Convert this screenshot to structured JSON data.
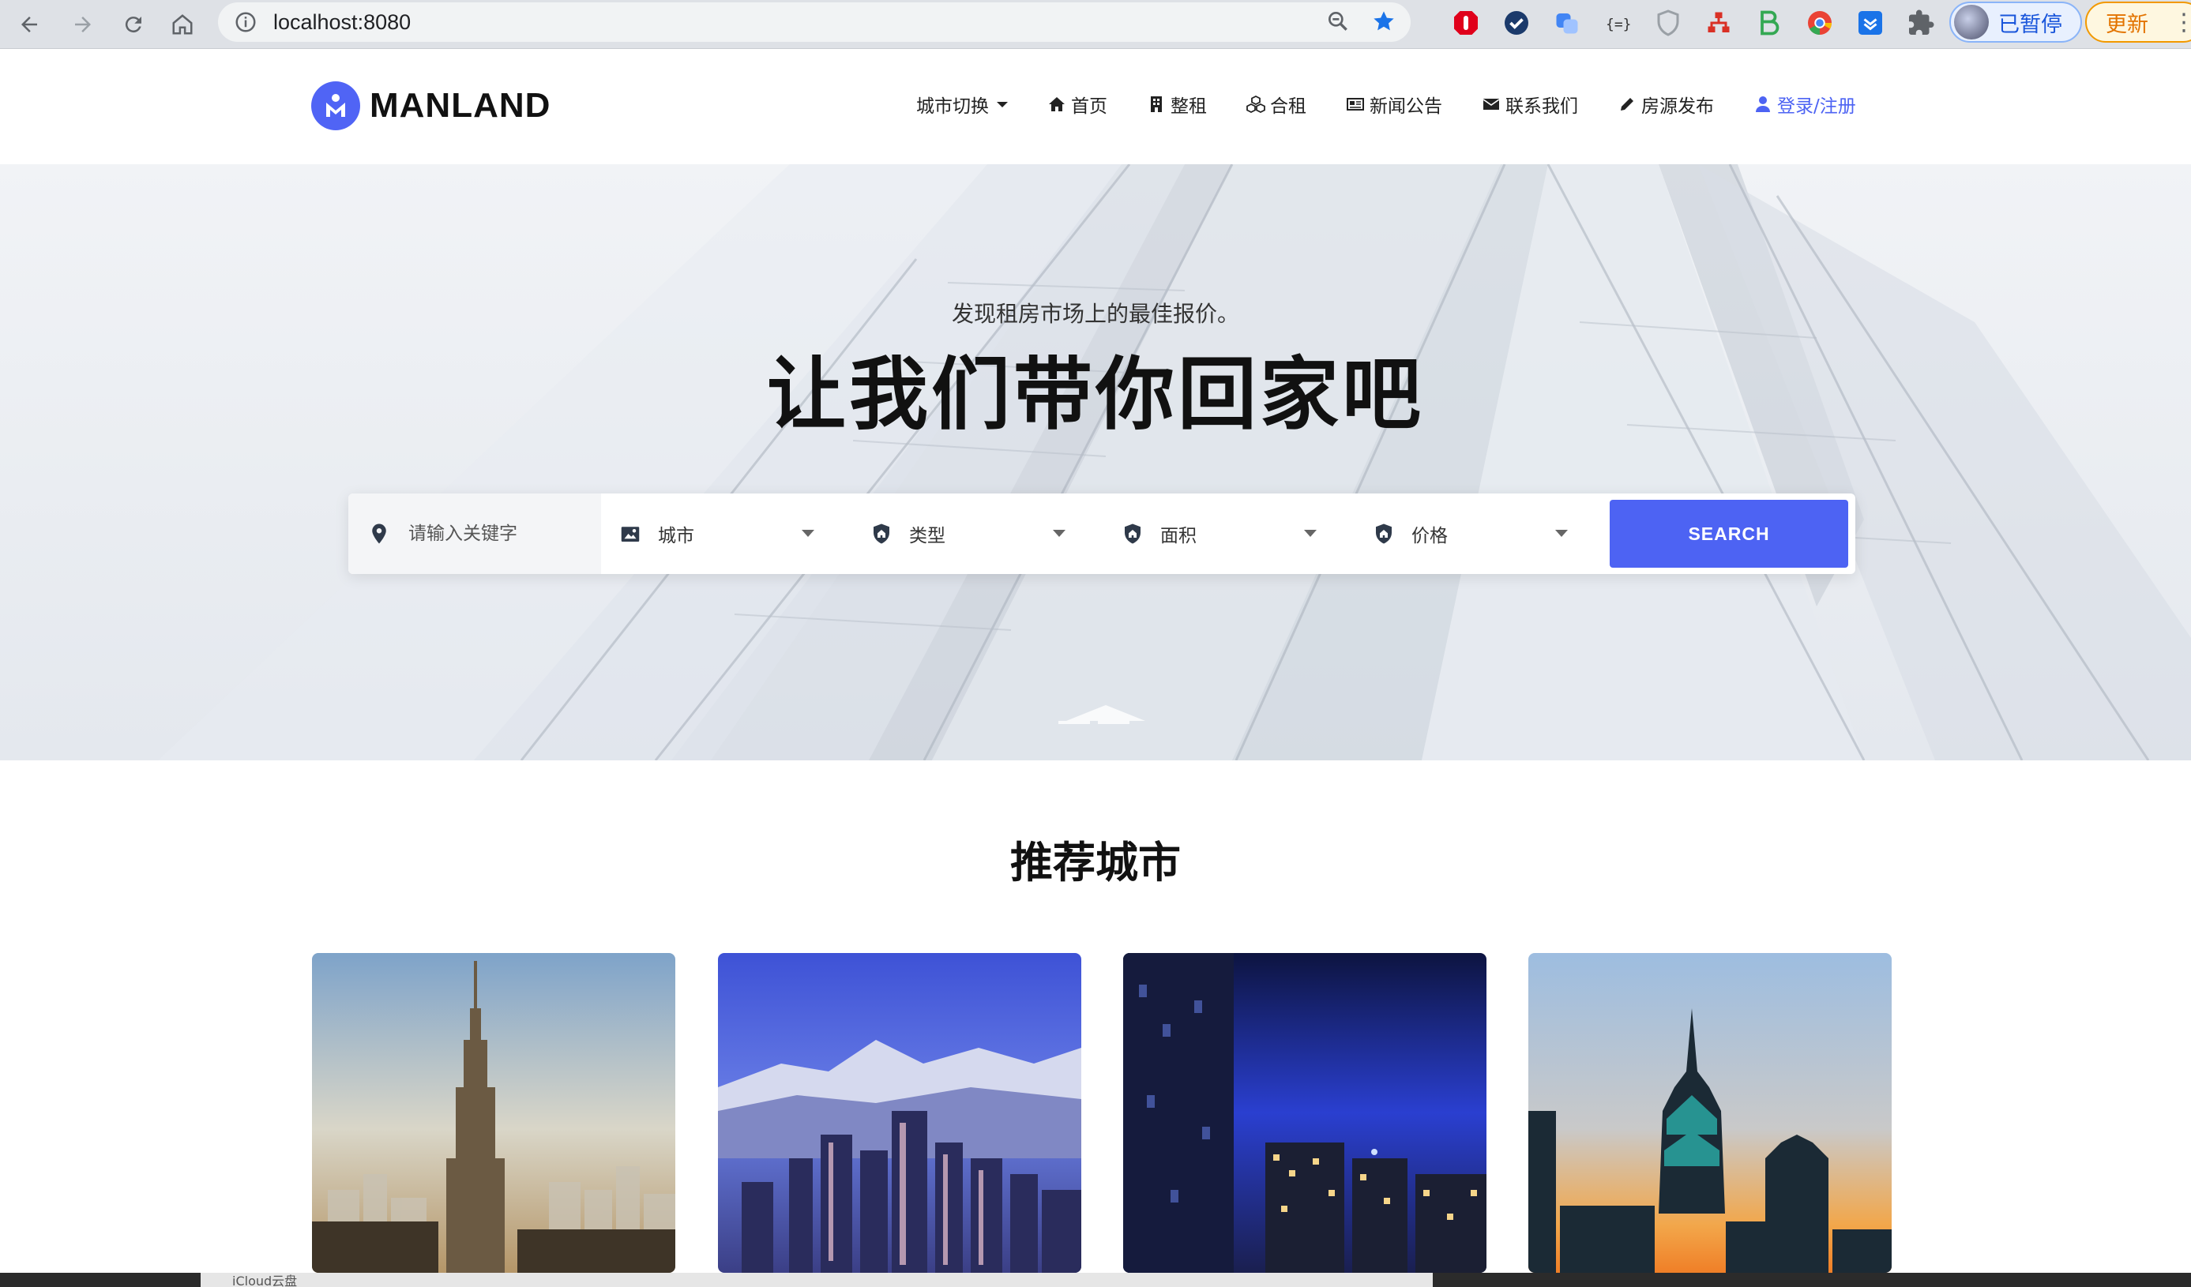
{
  "browser": {
    "url": "localhost:8080",
    "profile_label": "已暂停",
    "update_label": "更新"
  },
  "site": {
    "brand": "MANLAND",
    "nav": [
      {
        "label": "城市切换",
        "icon": "caret-down-icon"
      },
      {
        "label": "首页",
        "icon": "home-icon"
      },
      {
        "label": "整租",
        "icon": "building-icon"
      },
      {
        "label": "合租",
        "icon": "cubes-icon"
      },
      {
        "label": "新闻公告",
        "icon": "newspaper-icon"
      },
      {
        "label": "联系我们",
        "icon": "envelope-icon"
      },
      {
        "label": "房源发布",
        "icon": "pencil-icon"
      },
      {
        "label": "登录/注册",
        "icon": "user-icon"
      }
    ]
  },
  "hero": {
    "subtitle": "发现租房市场上的最佳报价。",
    "title": "让我们带你回家吧",
    "search": {
      "keyword_placeholder": "请输入关键字",
      "city": "城市",
      "type": "类型",
      "area": "面积",
      "price": "价格",
      "button": "SEARCH"
    }
  },
  "cities_section": {
    "title": "推荐城市",
    "cards": [
      {
        "scene": "empire-state-skyline"
      },
      {
        "scene": "mountain-downtown-skyline"
      },
      {
        "scene": "night-towers-skyline"
      },
      {
        "scene": "sunset-spire-skyline"
      }
    ]
  },
  "dock": {
    "tab_label": "iCloud云盘"
  },
  "colors": {
    "accent": "#4d63f3",
    "logo": "#5064f5"
  }
}
